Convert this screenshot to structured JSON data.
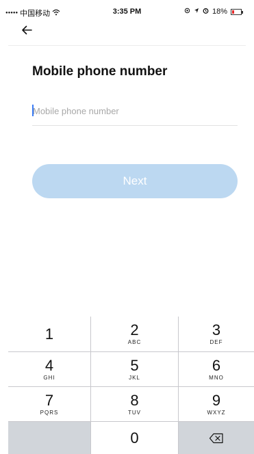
{
  "status_bar": {
    "signal": "●●●●●",
    "carrier": "中国移动",
    "wifi": "ᯤ",
    "time": "3:35 PM",
    "battery_percent": "18%",
    "battery_level": 0.18
  },
  "nav": {
    "back_icon": "left-arrow-icon"
  },
  "main": {
    "title": "Mobile phone number",
    "phone_input": {
      "placeholder": "Mobile phone number",
      "value": ""
    },
    "next_label": "Next",
    "next_color": "#bcd8f1"
  },
  "keypad": {
    "keys": [
      {
        "digit": "1",
        "letters": ""
      },
      {
        "digit": "2",
        "letters": "ABC"
      },
      {
        "digit": "3",
        "letters": "DEF"
      },
      {
        "digit": "4",
        "letters": "GHI"
      },
      {
        "digit": "5",
        "letters": "JKL"
      },
      {
        "digit": "6",
        "letters": "MNO"
      },
      {
        "digit": "7",
        "letters": "PQRS"
      },
      {
        "digit": "8",
        "letters": "TUV"
      },
      {
        "digit": "9",
        "letters": "WXYZ"
      },
      {
        "digit": "0",
        "letters": ""
      }
    ],
    "delete_icon": "backspace-icon"
  }
}
